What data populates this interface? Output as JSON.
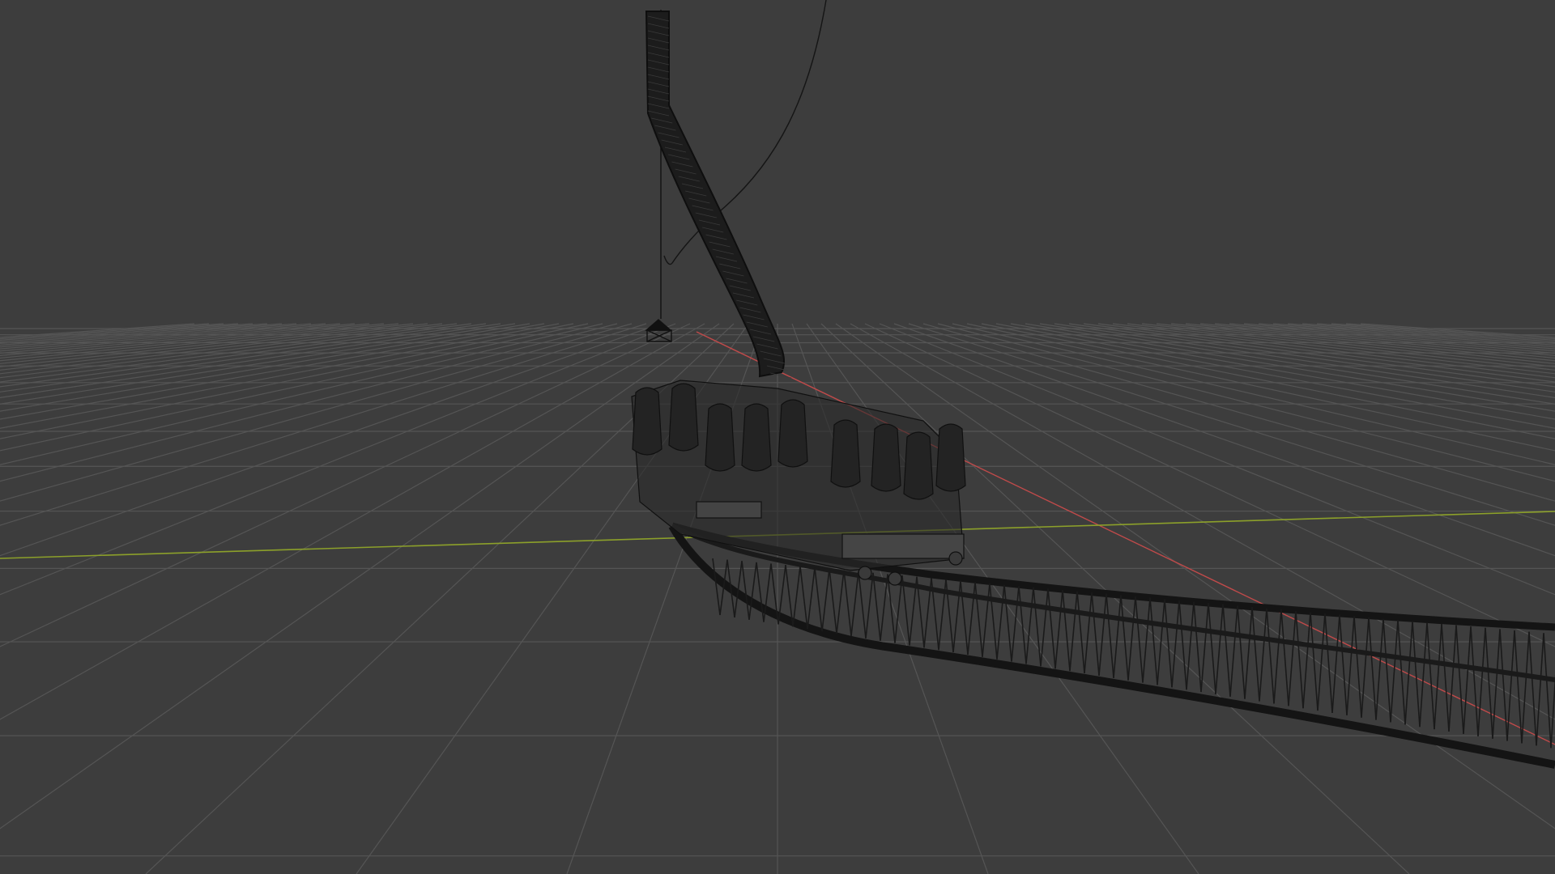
{
  "viewport": {
    "background_color": "#3d3d3d",
    "grid_color": "#555555",
    "axis_x_color": "#c04a4a",
    "axis_y_color": "#8ca02a",
    "wire_color": "#111111",
    "grid_visible": true,
    "shading": "wireframe",
    "objects": [
      {
        "name": "roller-coaster-track",
        "icon": "track-mesh"
      },
      {
        "name": "coaster-train-seats",
        "icon": "seat-mesh"
      },
      {
        "name": "camera",
        "icon": "camera-icon"
      },
      {
        "name": "path-curve",
        "icon": "curve-icon"
      }
    ]
  }
}
